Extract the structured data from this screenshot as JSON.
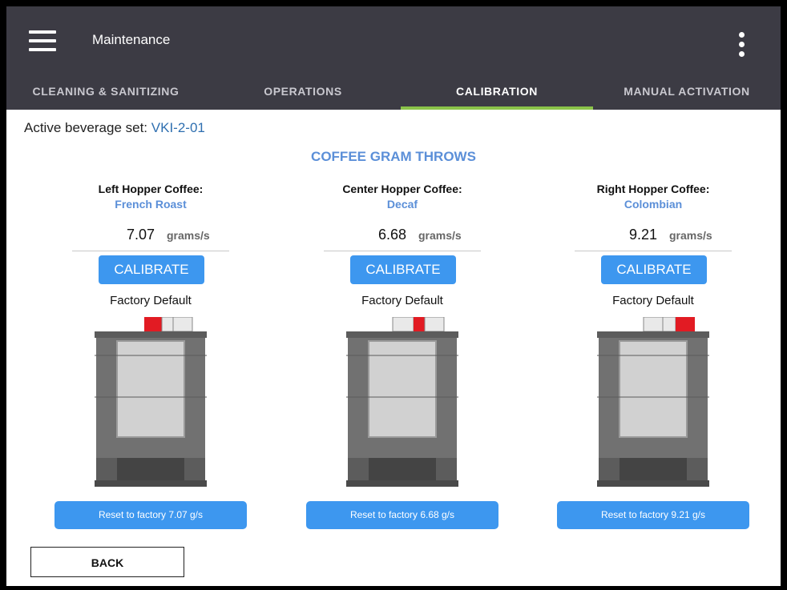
{
  "app": {
    "title": "Maintenance"
  },
  "tabs": [
    {
      "label": "CLEANING & SANITIZING"
    },
    {
      "label": "OPERATIONS"
    },
    {
      "label": "CALIBRATION"
    },
    {
      "label": "MANUAL ACTIVATION"
    }
  ],
  "active_tab": "CALIBRATION",
  "beverage_set": {
    "label": "Active beverage set:",
    "value": "VKI-2-01"
  },
  "section_title": "COFFEE GRAM THROWS",
  "hoppers": [
    {
      "label": "Left Hopper Coffee:",
      "coffee": "French Roast",
      "value": "7.07",
      "unit": "grams/s",
      "calibrate": "CALIBRATE",
      "default_label": "Factory Default",
      "reset": "Reset to factory 7.07 g/s",
      "highlight": "left"
    },
    {
      "label": "Center Hopper Coffee:",
      "coffee": "Decaf",
      "value": "6.68",
      "unit": "grams/s",
      "calibrate": "CALIBRATE",
      "default_label": "Factory Default",
      "reset": "Reset to factory 6.68 g/s",
      "highlight": "center"
    },
    {
      "label": "Right Hopper Coffee:",
      "coffee": "Colombian",
      "value": "9.21",
      "unit": "grams/s",
      "calibrate": "CALIBRATE",
      "default_label": "Factory Default",
      "reset": "Reset to factory 9.21 g/s",
      "highlight": "right"
    }
  ],
  "back": "BACK",
  "colors": {
    "header": "#3c3b44",
    "accent": "#3d97ef",
    "tab_indicator": "#8bc34a",
    "link": "#5b8fd8",
    "hopper_highlight": "#e21b23"
  }
}
